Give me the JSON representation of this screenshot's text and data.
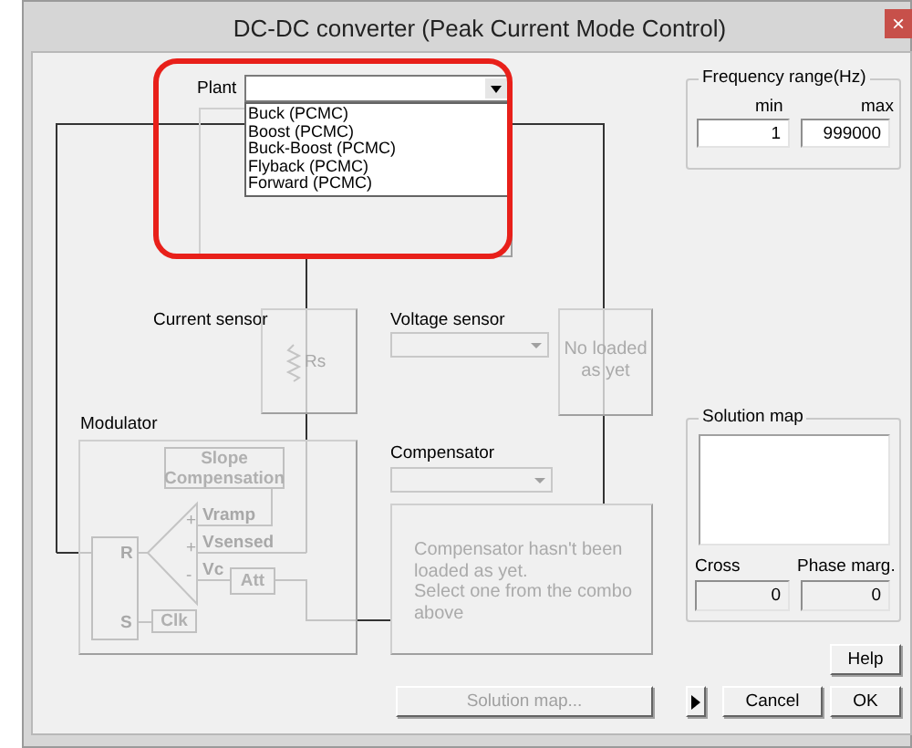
{
  "window": {
    "title": "DC-DC converter (Peak Current Mode Control)",
    "close": "×"
  },
  "plant": {
    "label": "Plant",
    "options": [
      {
        "label": "Buck (PCMC)",
        "selected": false
      },
      {
        "label": "Boost (PCMC)",
        "selected": false
      },
      {
        "label": "Buck-Boost (PCMC)",
        "selected": false
      },
      {
        "label": "Flyback (PCMC)",
        "selected": false
      },
      {
        "label": "Forward (PCMC)",
        "selected": false
      }
    ]
  },
  "frequency": {
    "title": "Frequency range(Hz)",
    "min_label": "min",
    "max_label": "max",
    "min": "1",
    "max": "999000"
  },
  "current_sensor": {
    "label": "Current sensor",
    "resistor": "Rs"
  },
  "voltage_sensor": {
    "label": "Voltage sensor",
    "disabled": true,
    "note": "No loaded as yet"
  },
  "modulator": {
    "label": "Modulator",
    "slope": "Slope Compensation",
    "reset": "R",
    "set": "S",
    "clock": "Clk",
    "inputs": [
      {
        "sign": "+",
        "name": "Vramp"
      },
      {
        "sign": "+",
        "name": "Vsensed"
      },
      {
        "sign": "-",
        "name": "Vc"
      }
    ],
    "attenuator": "Att"
  },
  "compensator": {
    "label": "Compensator",
    "disabled": true,
    "note": "Compensator hasn't been loaded as yet.\nSelect one from the combo above"
  },
  "solution_map": {
    "title": "Solution map",
    "cross_label": "Cross",
    "phase_label": "Phase marg.",
    "cross": "0",
    "phase": "0"
  },
  "buttons": [
    {
      "kind": "help",
      "label": "Help",
      "disabled": false
    },
    {
      "kind": "solution",
      "label": "Solution map...",
      "disabled": true
    },
    {
      "kind": "cancel",
      "label": "Cancel",
      "disabled": false
    },
    {
      "kind": "ok",
      "label": "OK",
      "disabled": false
    }
  ],
  "highlight": {
    "shown": true
  }
}
